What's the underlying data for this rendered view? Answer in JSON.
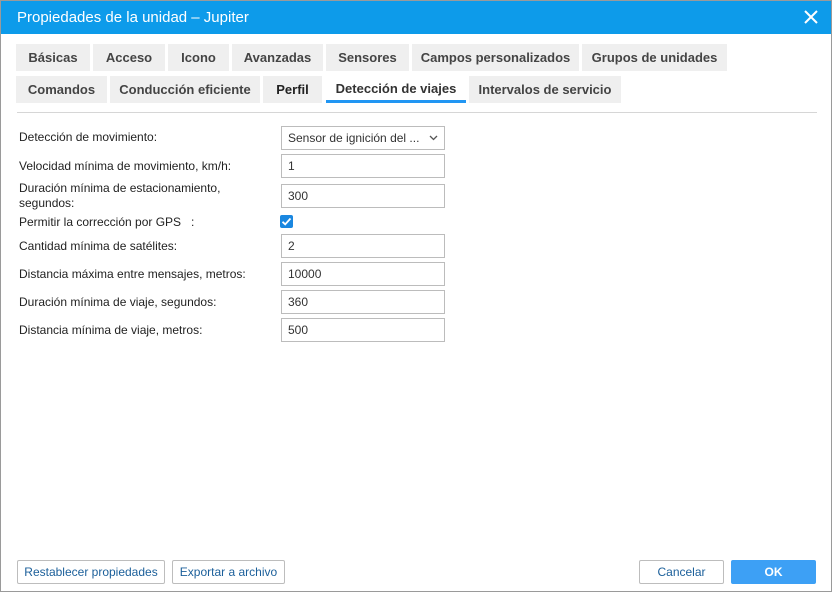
{
  "window": {
    "title": "Propiedades de la unidad – Jupiter"
  },
  "tabs": [
    {
      "label": "Básicas"
    },
    {
      "label": "Acceso"
    },
    {
      "label": "Icono"
    },
    {
      "label": "Avanzadas"
    },
    {
      "label": "Sensores"
    },
    {
      "label": "Campos personalizados"
    },
    {
      "label": "Grupos de unidades"
    },
    {
      "label": "Comandos"
    },
    {
      "label": "Conducción eficiente"
    },
    {
      "label": "Perfil"
    },
    {
      "label": "Detección de viajes",
      "active": true
    },
    {
      "label": "Intervalos de servicio"
    }
  ],
  "form": {
    "movement_detection": {
      "label": "Detección de movimiento:",
      "value": "Sensor de ignición del ..."
    },
    "min_speed": {
      "label": "Velocidad mínima de movimiento, km/h:",
      "value": "1"
    },
    "min_parking": {
      "label1": "Duración mínima de estacionamiento,",
      "label2": "segundos:",
      "value": "300"
    },
    "gps_correction": {
      "label": "Permitir la corrección por GPS   :",
      "checked": true
    },
    "min_satellites": {
      "label": "Cantidad mínima de satélites:",
      "value": "2"
    },
    "max_distance": {
      "label": "Distancia máxima entre mensajes, metros:",
      "value": "10000"
    },
    "min_trip_duration": {
      "label": "Duración mínima de viaje, segundos:",
      "value": "360"
    },
    "min_trip_distance": {
      "label": "Distancia mínima de viaje, metros:",
      "value": "500"
    }
  },
  "footer": {
    "reset": "Restablecer propiedades",
    "export": "Exportar a archivo",
    "cancel": "Cancelar",
    "ok": "OK"
  },
  "colors": {
    "accent": "#0d9bea",
    "ok": "#3da0f5"
  }
}
